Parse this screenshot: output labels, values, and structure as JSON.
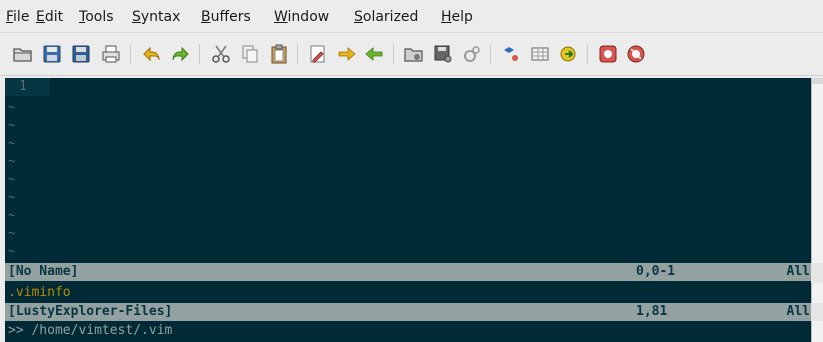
{
  "menu": {
    "items": [
      {
        "label": "File"
      },
      {
        "label": "Edit"
      },
      {
        "label": "Tools"
      },
      {
        "label": "Syntax"
      },
      {
        "label": "Buffers"
      },
      {
        "label": "Window"
      },
      {
        "label": "Solarized"
      },
      {
        "label": "Help"
      }
    ]
  },
  "toolbar": {
    "buttons": [
      {
        "icon": "open-folder-icon"
      },
      {
        "icon": "save-icon"
      },
      {
        "icon": "save-all-icon"
      },
      {
        "icon": "print-icon"
      },
      {
        "icon": "undo-icon"
      },
      {
        "icon": "redo-icon"
      },
      {
        "icon": "cut-icon"
      },
      {
        "icon": "copy-icon"
      },
      {
        "icon": "paste-icon"
      },
      {
        "icon": "find-replace-icon"
      },
      {
        "icon": "find-next-icon"
      },
      {
        "icon": "find-previous-icon"
      },
      {
        "icon": "load-session-icon"
      },
      {
        "icon": "save-session-icon"
      },
      {
        "icon": "run-script-icon"
      },
      {
        "icon": "make-icon"
      },
      {
        "icon": "shell-icon"
      },
      {
        "icon": "run-ctags-icon"
      },
      {
        "icon": "help-icon"
      },
      {
        "icon": "find-help-icon"
      }
    ]
  },
  "editor": {
    "line_number": "1",
    "empty_line_marker": "~",
    "empty_line_count": 9,
    "background": "#002b36",
    "status_bar_bg": "#93a1a1",
    "status_text_color": "#073642",
    "file_color": "#b58900"
  },
  "main_window": {
    "status": {
      "name": "[No Name]",
      "position": "0,0-1",
      "percent": "All"
    }
  },
  "explorer_window": {
    "file": ".viminfo",
    "status": {
      "name": "[LustyExplorer-Files]",
      "position": "1,81",
      "percent": "All"
    }
  },
  "command_line": {
    "text": ">> /home/vimtest/.vim"
  }
}
